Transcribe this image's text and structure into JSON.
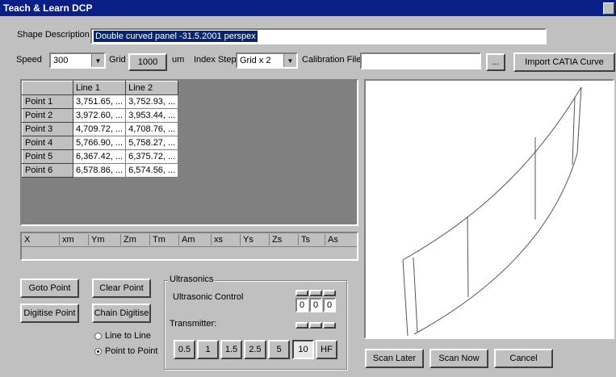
{
  "window": {
    "title": "Teach & Learn DCP"
  },
  "shape": {
    "label": "Shape Description",
    "value": "Double curved panel -31.5.2001 perspex"
  },
  "controls": {
    "speed_label": "Speed",
    "speed_value": "300",
    "grid_label": "Grid",
    "grid_value": "1000",
    "grid_unit": "um",
    "index_label": "Index Step",
    "index_value": "Grid x 2",
    "calib_label": "Calibration File:",
    "calib_value": "",
    "browse_label": "...",
    "import_label": "Import CATIA Curve"
  },
  "table": {
    "columns": [
      "",
      "Line 1",
      "Line 2"
    ],
    "rows": [
      {
        "name": "Point 1",
        "l1": "3,751.65, ...",
        "l2": "3,752.93, ..."
      },
      {
        "name": "Point 2",
        "l1": "3,972.60, ...",
        "l2": "3,953.44, ..."
      },
      {
        "name": "Point 3",
        "l1": "4,709.72, ...",
        "l2": "4,708.76, ..."
      },
      {
        "name": "Point 4",
        "l1": "5,766.90, ...",
        "l2": "5,758.27, ..."
      },
      {
        "name": "Point 5",
        "l1": "6,367.42, ...",
        "l2": "6,375.72, ..."
      },
      {
        "name": "Point 6",
        "l1": "6,578.86, ...",
        "l2": "6,574.56, ..."
      }
    ]
  },
  "coords": {
    "headers": [
      "X",
      "xm",
      "Ym",
      "Zm",
      "Tm",
      "Am",
      "xs",
      "Ys",
      "Zs",
      "Ts",
      "As"
    ]
  },
  "buttons": {
    "goto": "Goto Point",
    "clear": "Clear Point",
    "digitise": "Digitise Point",
    "chain": "Chain Digitise",
    "scan_later": "Scan Later",
    "scan_now": "Scan Now",
    "cancel": "Cancel"
  },
  "mode": {
    "line_to_line": "Line to Line",
    "point_to_point": "Point to Point",
    "selected": "point_to_point"
  },
  "ultrasonics": {
    "group_label": "Ultrasonics",
    "control_label": "Ultrasonic Control",
    "control_values": [
      "0",
      "0",
      "0"
    ],
    "transmitter_label": "Transmitter:",
    "freqs": [
      "0.5",
      "1",
      "1.5",
      "2.5",
      "5",
      "10",
      "HF"
    ],
    "selected_freq": "10"
  }
}
